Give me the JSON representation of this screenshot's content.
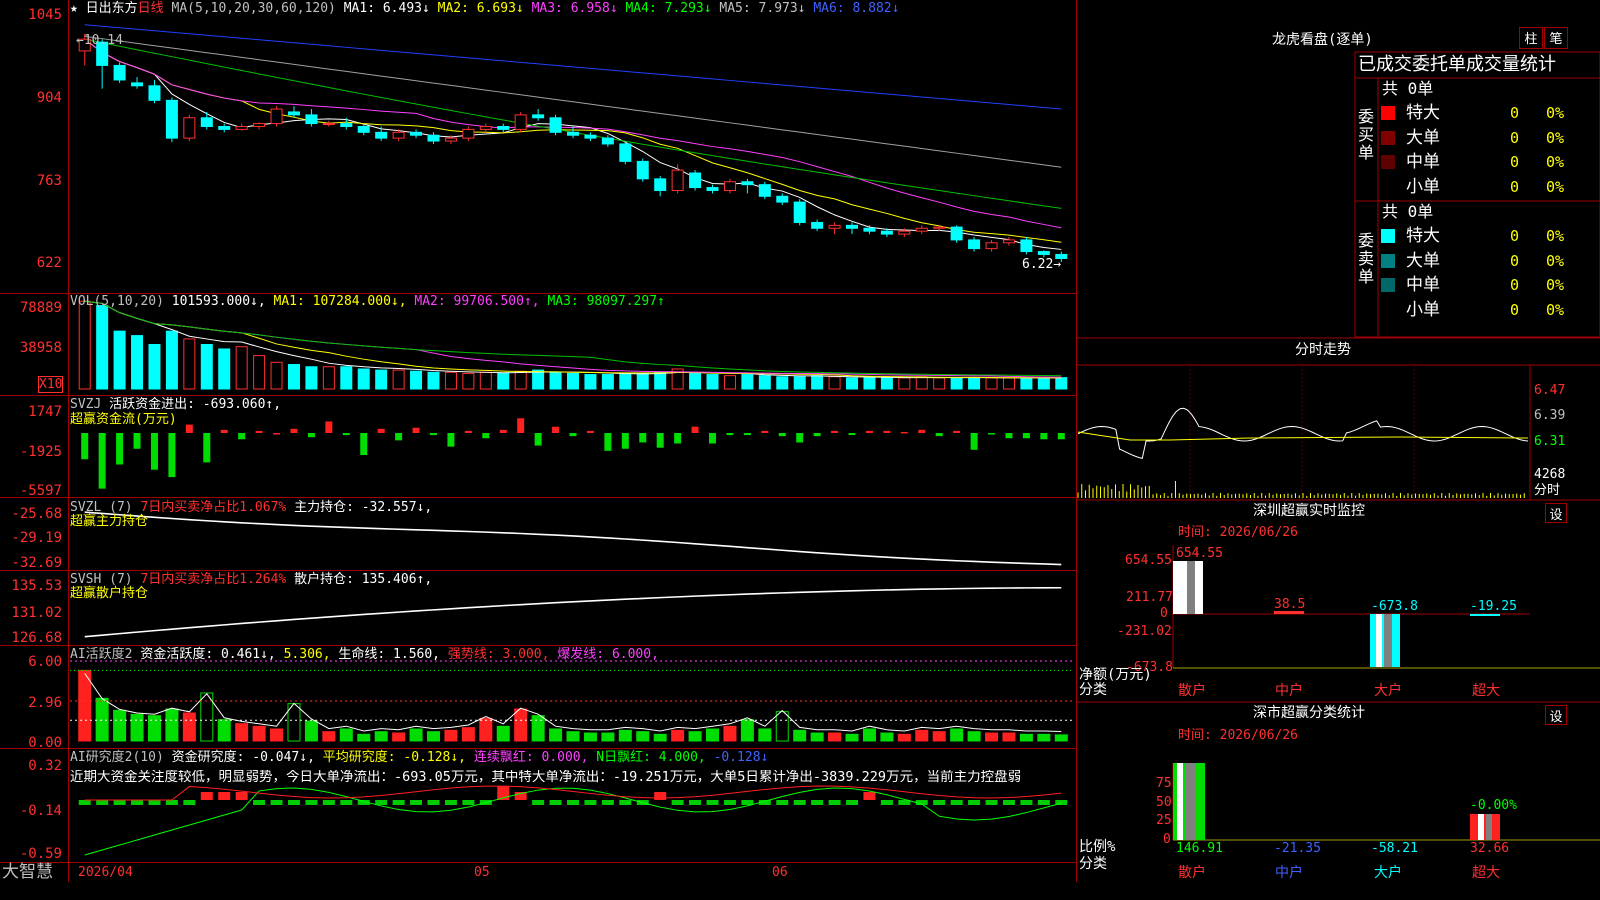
{
  "header": {
    "stock_name": "日出东方",
    "period": "日线",
    "ma_label": "MA(5,10,20,30,60,120)",
    "ma_values": [
      {
        "label": "MA1: ",
        "value": "6.493↓",
        "color": "#ffffff"
      },
      {
        "label": "MA2: ",
        "value": "6.693↓",
        "color": "#ffff00"
      },
      {
        "label": "MA3: ",
        "value": "6.958↓",
        "color": "#ff40ff"
      },
      {
        "label": "MA4: ",
        "value": "7.293↓",
        "color": "#00ff00"
      },
      {
        "label": "MA5: ",
        "value": "7.973↓",
        "color": "#c0c0c0"
      },
      {
        "label": "MA6: ",
        "value": "8.882↓",
        "color": "#4060ff"
      }
    ],
    "high_marker": "←10.14",
    "low_marker": "6.22→"
  },
  "price_axis": [
    "1045",
    "904",
    "763",
    "622"
  ],
  "vol": {
    "axis": [
      "78889",
      "38958"
    ],
    "unit": "X10",
    "label": "VOL(5,10,20)",
    "value": "101593.000↓,",
    "ma1": "MA1: 107284.000↓,",
    "ma2": "MA2: 99706.500↑,",
    "ma3": "MA3: 98097.297↑"
  },
  "svzj": {
    "axis": [
      "1747",
      "-1925",
      "-5597"
    ],
    "label": "SVZJ",
    "desc": "活跃资金进出: -693.060↑,",
    "sub": "超赢资金流(万元)"
  },
  "svzl": {
    "axis": [
      "-25.68",
      "-29.19",
      "-32.69"
    ],
    "label": "SVZL (7)",
    "desc": "7日内买卖净占比1.067%",
    "desc2": "主力持仓: -32.557↓,",
    "sub": "超赢主力持仓"
  },
  "svsh": {
    "axis": [
      "135.53",
      "131.02",
      "126.68"
    ],
    "label": "SVSH (7)",
    "desc": "7日内买卖净占比1.264%",
    "desc2": "散户持仓: 135.406↑,",
    "sub": "超赢散户持仓"
  },
  "ai1": {
    "axis": [
      "6.00",
      "2.96",
      "0.00"
    ],
    "label": "AI活跃度2",
    "v1": "资金活跃度: 0.461↓,",
    "v2": "5.306,",
    "v3": "生命线: 1.560,",
    "v4": "强势线: 3.000,",
    "v5": "爆发线: 6.000,"
  },
  "ai2": {
    "axis": [
      "0.32",
      "-0.14",
      "-0.59"
    ],
    "label": "AI研究度2(10)",
    "v1": "资金研究度: -0.047↓,",
    "v2": "平均研究度: -0.128↓,",
    "v3": "连续飘红: 0.000,",
    "v4": "N日飘红: 4.000,",
    "v5": "-0.128↓",
    "comment": "近期大资金关注度较低，明显弱势，今日大单净流出：-693.05万元，其中特大单净流出：-19.251万元，大单5日累计净出-3839.229万元，当前主力控盘弱"
  },
  "bottom": {
    "brand": "大智慧",
    "dates": [
      "2026/04",
      "05",
      "06"
    ]
  },
  "right": {
    "lhb_title": "龙虎看盘(逐单)",
    "tab1": "柱",
    "tab2": "笔",
    "stat_title": "已成交委托单成交量统计",
    "buy_total": "共 0单",
    "buy_side": "委买单",
    "sell_total": "共 0单",
    "sell_side": "委卖单",
    "buy_rows": [
      {
        "name": "特大",
        "count": "0",
        "pct": "0%",
        "color": "#ff0000"
      },
      {
        "name": "大单",
        "count": "0",
        "pct": "0%",
        "color": "#800000"
      },
      {
        "name": "中单",
        "count": "0",
        "pct": "0%",
        "color": "#600000"
      },
      {
        "name": "小单",
        "count": "0",
        "pct": "0%",
        "color": "#000000"
      }
    ],
    "sell_rows": [
      {
        "name": "特大",
        "count": "0",
        "pct": "0%",
        "color": "#00ffff"
      },
      {
        "name": "大单",
        "count": "0",
        "pct": "0%",
        "color": "#008080"
      },
      {
        "name": "中单",
        "count": "0",
        "pct": "0%",
        "color": "#006868"
      },
      {
        "name": "小单",
        "count": "0",
        "pct": "0%",
        "color": "#000000"
      }
    ],
    "intraday_title": "分时走势",
    "intraday_axis": [
      "6.47",
      "6.39",
      "6.31"
    ],
    "intraday_vol": "4268",
    "intraday_vol_unit": "分时",
    "monitor_title": "深圳超赢实时监控",
    "set1": "设",
    "monitor_time": "时间: 2026/06/26",
    "monitor_axis": [
      "654.55",
      "211.77",
      "0",
      "-231.02",
      "-673.8"
    ],
    "monitor_values": [
      "654.55",
      "38.5",
      "-673.8",
      "-19.25"
    ],
    "monitor_ylabel": "净额(万元)",
    "monitor_xlabel": "分类",
    "categories": [
      "散户",
      "中户",
      "大户",
      "超大"
    ],
    "cls_title": "深市超赢分类统计",
    "set2": "设",
    "cls_time": "时间: 2026/06/26",
    "cls_axis": [
      "75",
      "50",
      "25",
      "0"
    ],
    "cls_values": [
      "146.91",
      "-21.35",
      "-58.21",
      "32.66"
    ],
    "cls_top": "-0.00%",
    "cls_ylabel": "比例%",
    "cls_xlabel": "分类"
  },
  "chart_data": {
    "type": "candlestick",
    "price_range": [
      6.22,
      10.45
    ],
    "high": 10.14,
    "low": 6.22,
    "candles": [
      [
        9.85,
        10.14,
        9.6,
        10.05
      ],
      [
        10.0,
        10.05,
        9.2,
        9.6
      ],
      [
        9.6,
        9.65,
        9.3,
        9.35
      ],
      [
        9.3,
        9.4,
        9.2,
        9.25
      ],
      [
        9.25,
        9.35,
        8.95,
        9.0
      ],
      [
        9.0,
        9.05,
        8.28,
        8.35
      ],
      [
        8.35,
        8.75,
        8.3,
        8.7
      ],
      [
        8.7,
        8.8,
        8.5,
        8.55
      ],
      [
        8.55,
        8.6,
        8.45,
        8.5
      ],
      [
        8.5,
        8.6,
        8.48,
        8.55
      ],
      [
        8.55,
        8.62,
        8.5,
        8.6
      ],
      [
        8.6,
        8.9,
        8.55,
        8.85
      ],
      [
        8.8,
        8.9,
        8.7,
        8.75
      ],
      [
        8.75,
        8.85,
        8.55,
        8.6
      ],
      [
        8.6,
        8.65,
        8.55,
        8.6
      ],
      [
        8.6,
        8.7,
        8.5,
        8.55
      ],
      [
        8.55,
        8.6,
        8.4,
        8.45
      ],
      [
        8.45,
        8.55,
        8.3,
        8.35
      ],
      [
        8.35,
        8.5,
        8.3,
        8.45
      ],
      [
        8.45,
        8.5,
        8.35,
        8.4
      ],
      [
        8.4,
        8.45,
        8.25,
        8.3
      ],
      [
        8.3,
        8.4,
        8.25,
        8.35
      ],
      [
        8.35,
        8.55,
        8.3,
        8.5
      ],
      [
        8.5,
        8.6,
        8.45,
        8.55
      ],
      [
        8.55,
        8.6,
        8.45,
        8.5
      ],
      [
        8.5,
        8.8,
        8.45,
        8.75
      ],
      [
        8.75,
        8.85,
        8.65,
        8.7
      ],
      [
        8.7,
        8.75,
        8.4,
        8.45
      ],
      [
        8.45,
        8.55,
        8.35,
        8.4
      ],
      [
        8.4,
        8.45,
        8.3,
        8.35
      ],
      [
        8.35,
        8.4,
        8.2,
        8.25
      ],
      [
        8.25,
        8.3,
        7.9,
        7.95
      ],
      [
        7.95,
        8.0,
        7.6,
        7.65
      ],
      [
        7.65,
        7.7,
        7.35,
        7.45
      ],
      [
        7.45,
        7.9,
        7.4,
        7.8
      ],
      [
        7.75,
        7.8,
        7.45,
        7.5
      ],
      [
        7.5,
        7.55,
        7.4,
        7.45
      ],
      [
        7.45,
        7.65,
        7.4,
        7.6
      ],
      [
        7.6,
        7.65,
        7.4,
        7.55
      ],
      [
        7.55,
        7.6,
        7.3,
        7.35
      ],
      [
        7.35,
        7.4,
        7.2,
        7.25
      ],
      [
        7.25,
        7.3,
        6.85,
        6.9
      ],
      [
        6.9,
        6.95,
        6.75,
        6.8
      ],
      [
        6.8,
        6.9,
        6.7,
        6.85
      ],
      [
        6.85,
        6.9,
        6.7,
        6.8
      ],
      [
        6.8,
        6.85,
        6.7,
        6.75
      ],
      [
        6.75,
        6.8,
        6.65,
        6.7
      ],
      [
        6.7,
        6.8,
        6.65,
        6.75
      ],
      [
        6.75,
        6.85,
        6.7,
        6.8
      ],
      [
        6.8,
        6.85,
        6.75,
        6.82
      ],
      [
        6.82,
        6.85,
        6.55,
        6.6
      ],
      [
        6.6,
        6.65,
        6.4,
        6.45
      ],
      [
        6.45,
        6.6,
        6.4,
        6.55
      ],
      [
        6.55,
        6.65,
        6.5,
        6.6
      ],
      [
        6.6,
        6.65,
        6.35,
        6.4
      ],
      [
        6.4,
        6.42,
        6.3,
        6.35
      ],
      [
        6.35,
        6.4,
        6.22,
        6.28
      ]
    ],
    "volumes": [
      78889,
      75000,
      52000,
      48000,
      40000,
      52000,
      45000,
      40000,
      36000,
      38000,
      30000,
      24000,
      22000,
      20000,
      20000,
      20000,
      18000,
      17000,
      17000,
      16000,
      15000,
      15000,
      14000,
      15000,
      14000,
      16000,
      17000,
      15000,
      14000,
      13000,
      13000,
      14000,
      14000,
      15000,
      18000,
      14000,
      13000,
      12000,
      13000,
      12000,
      11000,
      11000,
      12000,
      11000,
      10000,
      10000,
      10000,
      10000,
      11000,
      10000,
      10000,
      10000,
      10000,
      10000,
      10000,
      10000,
      10200
    ]
  }
}
